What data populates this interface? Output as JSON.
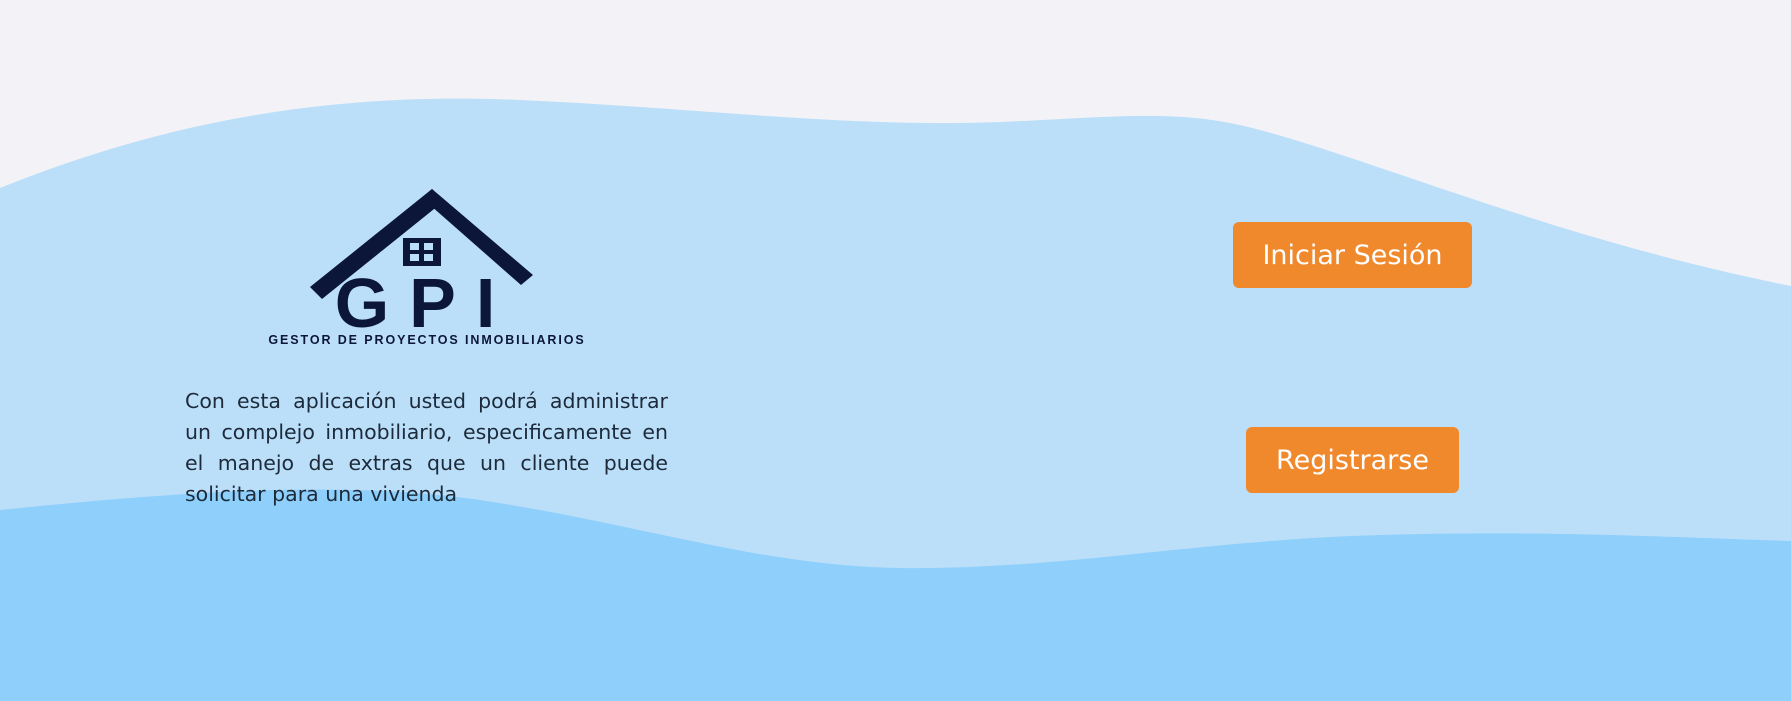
{
  "logo": {
    "title": "GPI",
    "subtitle": "GESTOR DE PROYECTOS INMOBILIARIOS",
    "icon": "house-roof-icon"
  },
  "description": "Con esta aplicación usted podrá administrar un complejo inmobiliario, especificamente en el manejo de extras que un cliente puede solicitar para una vivienda",
  "actions": {
    "login_label": "Iniciar Sesión",
    "register_label": "Registrarse"
  },
  "colors": {
    "background": "#f3f2f7",
    "wave_light": "#bcdff9",
    "wave_dark": "#8fcffb",
    "button": "#f0882c",
    "logo": "#0c1638"
  }
}
